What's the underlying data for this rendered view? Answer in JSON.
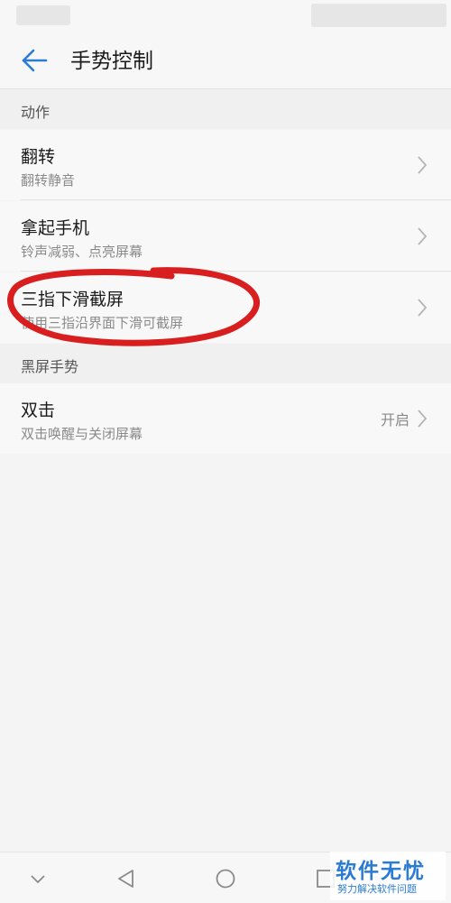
{
  "header": {
    "title": "手势控制",
    "back_icon": "arrow-left-icon",
    "accent_color": "#2b7bd3"
  },
  "sections": [
    {
      "label": "动作",
      "items": [
        {
          "title": "翻转",
          "subtitle": "翻转静音"
        },
        {
          "title": "拿起手机",
          "subtitle": "铃声减弱、点亮屏幕"
        },
        {
          "title": "三指下滑截屏",
          "subtitle": "使用三指沿界面下滑可截屏"
        }
      ]
    },
    {
      "label": "黑屏手势",
      "items": [
        {
          "title": "双击",
          "subtitle": "双击唤醒与关闭屏幕",
          "value": "开启"
        }
      ]
    }
  ],
  "annotation": {
    "color": "#d81e1e"
  },
  "nav": {
    "buttons": [
      "chevron-down-icon",
      "back-triangle-icon",
      "home-circle-icon",
      "recents-square-icon"
    ]
  },
  "watermark": {
    "main": "软件无忧",
    "sub": "努力解决软件问题"
  }
}
